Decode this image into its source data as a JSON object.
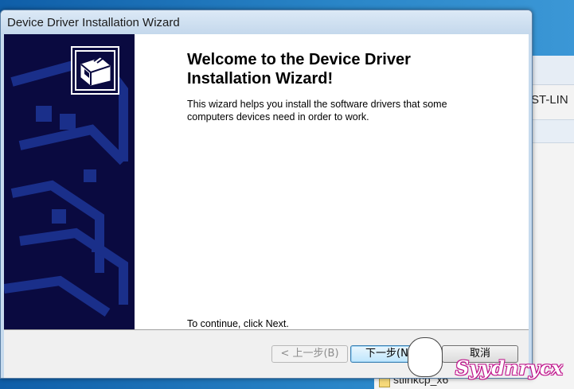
{
  "window": {
    "title": "Device Driver Installation Wizard"
  },
  "wizard": {
    "heading": "Welcome to the Device Driver Installation Wizard!",
    "description": "This wizard helps you install the software drivers that some computers devices need in order to work.",
    "continue_text": "To continue, click Next.",
    "logo_icon": "driver-install-icon"
  },
  "buttons": {
    "back": "< 上一步(B)",
    "next": "下一步(N) >",
    "cancel": "取消"
  },
  "background_window": {
    "tab_label": "ST-LIN",
    "file_label": "stlinkcp_x6"
  },
  "watermark": {
    "text": "Syydnrycx",
    "icon": "cartoon-face-icon"
  },
  "colors": {
    "sidebar": "#0a0a40",
    "sidebar_pattern": "#1a2f8a",
    "titlebar": "#c4d8ec",
    "watermark": "#c0178d"
  }
}
